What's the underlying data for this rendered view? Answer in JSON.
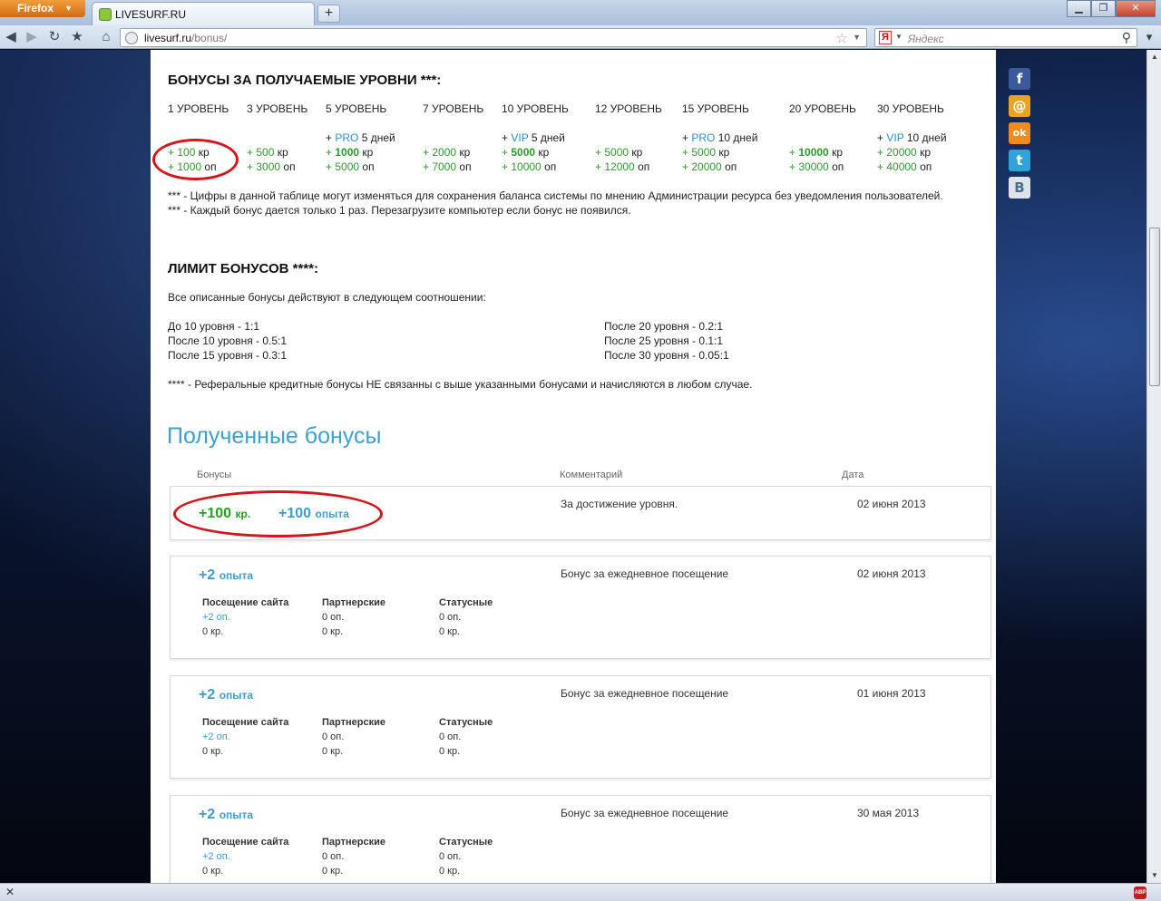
{
  "browser": {
    "firefox_label": "Firefox",
    "tab_title": "LIVESURF.RU",
    "new_tab": "+",
    "url_host": "livesurf.ru",
    "url_path": "/bonus/",
    "search_placeholder": "Яндекс",
    "search_engine_letter": "Я"
  },
  "levels": {
    "title": "БОНУСЫ ЗА ПОЛУЧАЕМЫЕ УРОВНИ ***:",
    "columns": [
      {
        "head": "1 УРОВЕНЬ",
        "extra_tag": "",
        "extra_text": "",
        "kr_plus": "+",
        "kr_val": "100",
        "kr_unit": "кр",
        "op_plus": "+",
        "op_val": "1000",
        "op_unit": "оп"
      },
      {
        "head": "3 УРОВЕНЬ",
        "extra_tag": "",
        "extra_text": "",
        "kr_plus": "+",
        "kr_val": "500",
        "kr_unit": "кр",
        "op_plus": "+",
        "op_val": "3000",
        "op_unit": "оп"
      },
      {
        "head": "5 УРОВЕНЬ",
        "extra_plus": "+",
        "extra_tag": "PRO",
        "extra_text": "5 дней",
        "kr_plus": "+",
        "kr_val": "1000",
        "kr_unit": "кр",
        "op_plus": "+",
        "op_val": "5000",
        "op_unit": "оп"
      },
      {
        "head": "7 УРОВЕНЬ",
        "extra_tag": "",
        "extra_text": "",
        "kr_plus": "+",
        "kr_val": "2000",
        "kr_unit": "кр",
        "op_plus": "+",
        "op_val": "7000",
        "op_unit": "оп"
      },
      {
        "head": "10 УРОВЕНЬ",
        "extra_plus": "+",
        "extra_tag": "VIP",
        "extra_text": "5 дней",
        "kr_plus": "+",
        "kr_val": "5000",
        "kr_unit": "кр",
        "op_plus": "+",
        "op_val": "10000",
        "op_unit": "оп"
      },
      {
        "head": "12 УРОВЕНЬ",
        "extra_tag": "",
        "extra_text": "",
        "kr_plus": "+",
        "kr_val": "5000",
        "kr_unit": "кр",
        "op_plus": "+",
        "op_val": "12000",
        "op_unit": "оп"
      },
      {
        "head": "15 УРОВЕНЬ",
        "extra_plus": "+",
        "extra_tag": "PRO",
        "extra_text": "10 дней",
        "kr_plus": "+",
        "kr_val": "5000",
        "kr_unit": "кр",
        "op_plus": "+",
        "op_val": "20000",
        "op_unit": "оп"
      },
      {
        "head": "20 УРОВЕНЬ",
        "extra_tag": "",
        "extra_text": "",
        "kr_plus": "+",
        "kr_val": "10000",
        "kr_unit": "кр",
        "op_plus": "+",
        "op_val": "30000",
        "op_unit": "оп"
      },
      {
        "head": "30 УРОВЕНЬ",
        "extra_plus": "+",
        "extra_tag": "VIP",
        "extra_text": "10 дней",
        "kr_plus": "+",
        "kr_val": "20000",
        "kr_unit": "кр",
        "op_plus": "+",
        "op_val": "40000",
        "op_unit": "оп"
      }
    ],
    "note1": "*** - Цифры в данной таблице могут изменяться для сохранения баланса системы по мнению Администрации ресурса без уведомления пользователей.",
    "note2": "*** - Каждый бонус дается только 1 раз. Перезагрузите компьютер если бонус не появился."
  },
  "limits": {
    "title": "ЛИМИТ БОНУСОВ ****:",
    "intro": "Все описанные бонусы действуют в следующем соотношении:",
    "left": [
      "До 10 уровня - 1:1",
      "После 10 уровня - 0.5:1",
      "После 15 уровня - 0.3:1"
    ],
    "right": [
      "После 20 уровня - 0.2:1",
      "После 25 уровня - 0.1:1",
      "После 30 уровня - 0.05:1"
    ],
    "note": "**** - Реферальные кредитные бонусы НЕ связанны с выше указанными бонусами и начисляются в любом случае."
  },
  "received": {
    "title": "Полученные бонусы",
    "col_bonus": "Бонусы",
    "col_comment": "Комментарий",
    "col_date": "Дата",
    "first": {
      "kr_amount": "+100",
      "kr_unit": "кр.",
      "op_amount": "+100",
      "op_unit": "опыта",
      "comment": "За достижение уровня.",
      "date": "02 июня 2013"
    },
    "sub_heads": [
      "Посещение сайта",
      "Партнерские",
      "Статусные"
    ],
    "daily": [
      {
        "amount": "+2",
        "unit": "опыта",
        "comment": "Бонус за ежедневное посещение",
        "date": "02 июня 2013",
        "visit_op": "+2 оп.",
        "visit_kr": "0 кр.",
        "partner_op": "0 оп.",
        "partner_kr": "0 кр.",
        "status_op": "0 оп.",
        "status_kr": "0 кр."
      },
      {
        "amount": "+2",
        "unit": "опыта",
        "comment": "Бонус за ежедневное посещение",
        "date": "01 июня 2013",
        "visit_op": "+2 оп.",
        "visit_kr": "0 кр.",
        "partner_op": "0 оп.",
        "partner_kr": "0 кр.",
        "status_op": "0 оп.",
        "status_kr": "0 кр."
      },
      {
        "amount": "+2",
        "unit": "опыта",
        "comment": "Бонус за ежедневное посещение",
        "date": "30 мая 2013",
        "visit_op": "+2 оп.",
        "visit_kr": "0 кр.",
        "partner_op": "0 оп.",
        "partner_kr": "0 кр.",
        "status_op": "0 оп.",
        "status_kr": "0 кр."
      }
    ]
  },
  "social": [
    "f",
    "@",
    "ok",
    "t",
    "В"
  ],
  "colors": {
    "accent_blue": "#3ba1d2",
    "bonus_green": "#22a322",
    "annotation_red": "#d8141b"
  }
}
